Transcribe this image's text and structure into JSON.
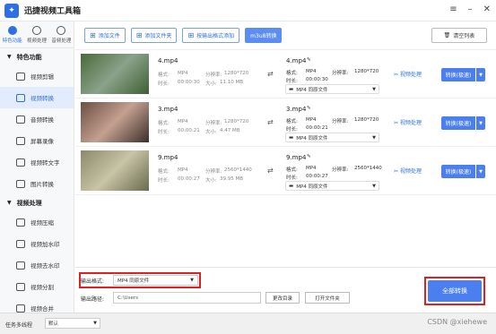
{
  "app": {
    "title": "迅捷视频工具箱",
    "logo_icon": "toolbox-icon"
  },
  "window_controls": [
    "menu-icon",
    "minimize-icon",
    "close-icon"
  ],
  "sidebar": {
    "top_tabs": [
      {
        "label": "特色功能",
        "icon": "star-icon",
        "active": true
      },
      {
        "label": "视频处理",
        "icon": "video-icon",
        "active": false
      },
      {
        "label": "音频处理",
        "icon": "audio-icon",
        "active": false
      }
    ],
    "sections": [
      {
        "title": "特色功能",
        "items": [
          {
            "label": "视频剪辑",
            "icon": "cut-icon"
          },
          {
            "label": "视频转换",
            "icon": "convert-icon",
            "active": true
          },
          {
            "label": "音频转换",
            "icon": "music-icon"
          },
          {
            "label": "屏幕录像",
            "icon": "record-icon"
          },
          {
            "label": "视频转文字",
            "icon": "text-icon"
          },
          {
            "label": "图片转换",
            "icon": "image-icon"
          }
        ]
      },
      {
        "title": "视频处理",
        "items": [
          {
            "label": "视频压缩",
            "icon": "compress-icon"
          },
          {
            "label": "视频加水印",
            "icon": "watermark-icon"
          },
          {
            "label": "视频去水印",
            "icon": "remove-watermark-icon"
          },
          {
            "label": "视频分割",
            "icon": "split-icon"
          },
          {
            "label": "视频合并",
            "icon": "merge-icon"
          }
        ]
      }
    ]
  },
  "toolbar": {
    "add_file": "添加文件",
    "add_folder": "添加文件夹",
    "add_by_format": "按输出格式添加",
    "m3u8": "m3u8转换",
    "clear_list": "清空列表"
  },
  "files": [
    {
      "src_name": "4.mp4",
      "src_format_lbl": "格式:",
      "src_format": "MP4",
      "src_res_lbl": "分辨率:",
      "src_res": "1280*720",
      "src_dur_lbl": "时长:",
      "src_dur": "00:00:30",
      "src_size_lbl": "大小:",
      "src_size": "11.10 MB",
      "out_name": "4.mp4",
      "out_format_lbl": "格式:",
      "out_format": "MP4",
      "out_res_lbl": "分辨率:",
      "out_res": "1280*720",
      "out_dur_lbl": "时长:",
      "out_dur": "00:00:30",
      "out_sel": "MP4 同原文件",
      "process": "视频处理",
      "convert": "转换(极速)",
      "thumb_colors": [
        "#4a6a3a",
        "#8aa28a",
        "#3e5f34"
      ]
    },
    {
      "src_name": "3.mp4",
      "src_format_lbl": "格式:",
      "src_format": "MP4",
      "src_res_lbl": "分辨率:",
      "src_res": "1280*720",
      "src_dur_lbl": "时长:",
      "src_dur": "00:00:21",
      "src_size_lbl": "大小:",
      "src_size": "4.47 MB",
      "out_name": "3.mp4",
      "out_format_lbl": "格式:",
      "out_format": "MP4",
      "out_res_lbl": "分辨率:",
      "out_res": "1280*720",
      "out_dur_lbl": "时长:",
      "out_dur": "00:00:21",
      "out_sel": "MP4 同原文件",
      "process": "视频处理",
      "convert": "转换(极速)",
      "thumb_colors": [
        "#6a4f43",
        "#c4a090",
        "#3b2f2a"
      ]
    },
    {
      "src_name": "9.mp4",
      "src_format_lbl": "格式:",
      "src_format": "MP4",
      "src_res_lbl": "分辨率:",
      "src_res": "2560*1440",
      "src_dur_lbl": "时长:",
      "src_dur": "00:00:27",
      "src_size_lbl": "大小:",
      "src_size": "39.95 MB",
      "out_name": "9.mp4",
      "out_format_lbl": "格式:",
      "out_format": "MP4",
      "out_res_lbl": "分辨率:",
      "out_res": "2560*1440",
      "out_dur_lbl": "时长:",
      "out_dur": "00:00:27",
      "out_sel": "MP4 同原文件",
      "process": "视频处理",
      "convert": "转换(极速)",
      "thumb_colors": [
        "#8a8a6a",
        "#c8c4a6",
        "#6a6a4e"
      ]
    }
  ],
  "bottom": {
    "output_format_label": "输出格式:",
    "output_format_value": "MP4 同原文件",
    "output_path_label": "输出路径:",
    "output_path_value": "C:\\Users",
    "change_dir": "更改目录",
    "open_folder": "打开文件夹",
    "convert_all": "全部转换"
  },
  "status": {
    "task_label": "任务多线程",
    "task_value": "默认",
    "watermark": "CSDN @xiehewe"
  },
  "colors": {
    "accent": "#4b7ff0",
    "highlight_box": "#e02020",
    "selected_bg": "#e3ecfd"
  }
}
